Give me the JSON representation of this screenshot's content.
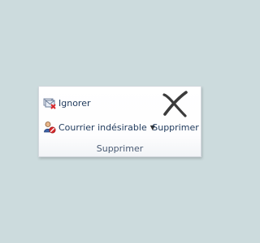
{
  "group": {
    "label": "Supprimer"
  },
  "buttons": {
    "ignore": {
      "label": "Ignorer",
      "icon": "ignore-conversation-icon"
    },
    "junk": {
      "label": "Courrier indésirable",
      "icon": "junk-mail-icon",
      "has_dropdown": true
    },
    "delete": {
      "label": "Supprimer",
      "icon": "delete-x-icon"
    }
  },
  "colors": {
    "background": "#ccdbdd",
    "label_text": "#1e395b",
    "group_label_text": "#4a5b74",
    "delete_icon": "#3b3b3b",
    "ignore_mark": "#d8282c",
    "junk_mark": "#d8282c"
  }
}
